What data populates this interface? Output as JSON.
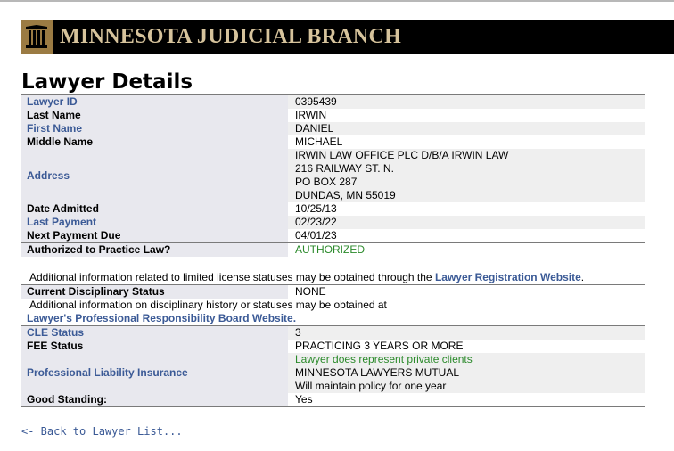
{
  "banner": {
    "title": "MINNESOTA JUDICIAL BRANCH",
    "logo_icon": "courthouse-columns-icon"
  },
  "page": {
    "title": "Lawyer Details"
  },
  "details": {
    "lawyer_id": {
      "label": "Lawyer ID",
      "value": "0395439"
    },
    "last_name": {
      "label": "Last Name",
      "value": "IRWIN"
    },
    "first_name": {
      "label": "First Name",
      "value": "DANIEL"
    },
    "middle_name": {
      "label": "Middle Name",
      "value": "MICHAEL"
    },
    "address": {
      "label": "Address",
      "lines": [
        "IRWIN LAW OFFICE PLC D/B/A IRWIN LAW",
        "216 RAILWAY ST. N.",
        "PO BOX 287",
        "DUNDAS, MN  55019"
      ]
    },
    "date_admitted": {
      "label": "Date Admitted",
      "value": "10/25/13"
    },
    "last_payment": {
      "label": "Last Payment",
      "value": "02/23/22"
    },
    "next_payment_due": {
      "label": "Next Payment Due",
      "value": "04/01/23"
    },
    "authorized": {
      "label": "Authorized to Practice Law?",
      "value": "AUTHORIZED"
    },
    "license_note": {
      "text": "Additional information related to limited license statuses may be obtained through the ",
      "link": "Lawyer Registration Website",
      "suffix": "."
    },
    "disciplinary": {
      "label": "Current Disciplinary Status",
      "value": "NONE"
    },
    "disciplinary_note": {
      "text": "Additional information on disciplinary history or statuses may be obtained at",
      "link": "Lawyer's Professional Responsibility Board Website",
      "suffix": "."
    },
    "cle_status": {
      "label": "CLE Status",
      "value": "3"
    },
    "fee_status": {
      "label": "FEE Status",
      "value": "PRACTICING 3 YEARS OR MORE"
    },
    "insurance": {
      "label": "Professional Liability Insurance",
      "represents": "Lawyer does represent private clients",
      "carrier": "MINNESOTA LAWYERS MUTUAL",
      "policy": "Will maintain policy for one year"
    },
    "good_standing": {
      "label": "Good Standing:",
      "value": "Yes"
    }
  },
  "footer": {
    "back_link": "<- Back to Lawyer List..."
  },
  "colors": {
    "banner_bg": "#000000",
    "banner_text": "#d6c39c",
    "logo_bg": "#9b7b43",
    "link_blue": "#3b5a96",
    "label_bg": "#e8e8ee",
    "authorized_green": "#2b8a2b"
  }
}
